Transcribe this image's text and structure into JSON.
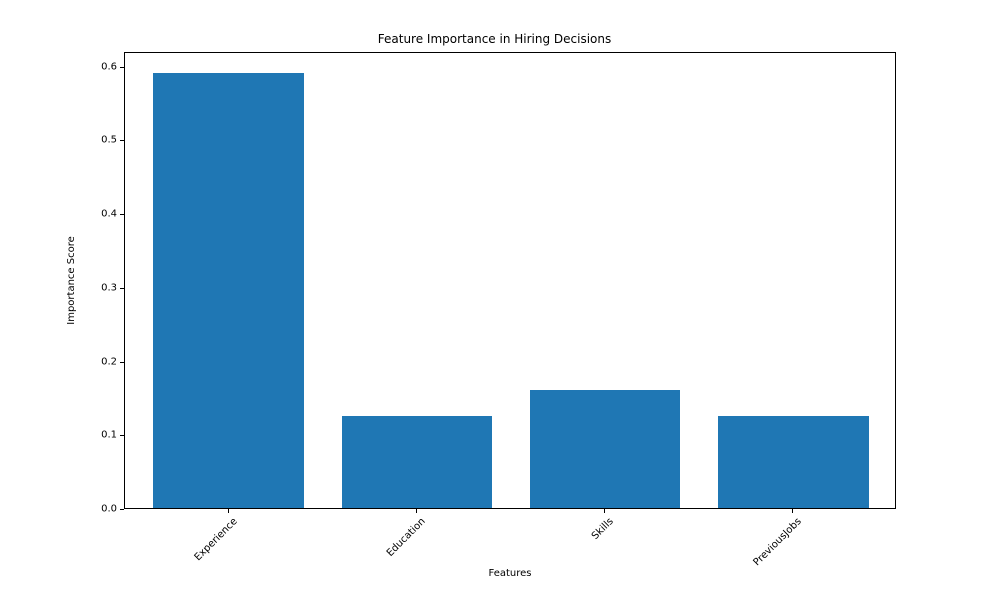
{
  "chart_data": {
    "type": "bar",
    "title": "Feature Importance in Hiring Decisions",
    "xlabel": "Features",
    "ylabel": "Importance Score",
    "categories": [
      "Experience",
      "Education",
      "Skills",
      "PreviousJobs"
    ],
    "values": [
      0.59,
      0.125,
      0.16,
      0.125
    ],
    "ylim": [
      0.0,
      0.62
    ],
    "yticks": [
      0.0,
      0.1,
      0.2,
      0.3,
      0.4,
      0.5,
      0.6
    ],
    "ytick_labels": [
      "0.0",
      "0.1",
      "0.2",
      "0.3",
      "0.4",
      "0.5",
      "0.6"
    ],
    "bar_color": "#1f77b4"
  }
}
